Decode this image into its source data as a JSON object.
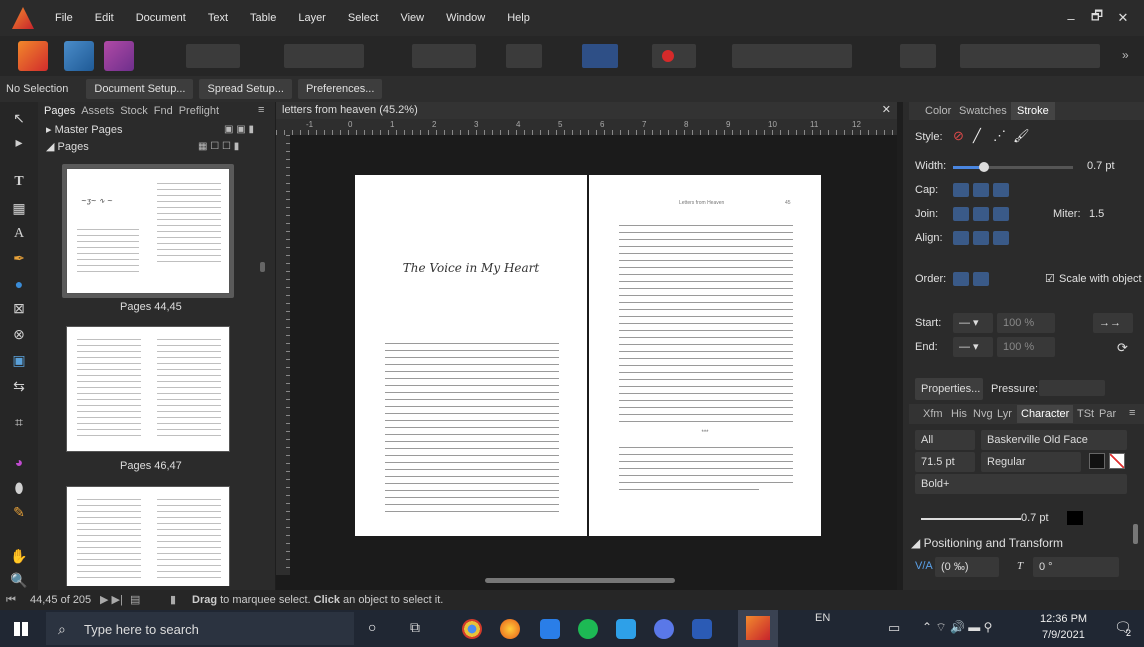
{
  "menubar": {
    "items": [
      "File",
      "Edit",
      "Document",
      "Text",
      "Table",
      "Layer",
      "Select",
      "View",
      "Window",
      "Help"
    ],
    "minimize": "–",
    "restore": "🗗",
    "close": "✕"
  },
  "context": {
    "selection": "No Selection",
    "buttons": [
      "Document Setup...",
      "Spread Setup...",
      "Preferences..."
    ]
  },
  "pages_panel": {
    "tabs": [
      "Pages",
      "Assets",
      "Stock",
      "Fnd",
      "Preflight"
    ],
    "master_pages": "Master Pages",
    "pages": "Pages",
    "spreads": [
      "Pages 44,45",
      "Pages 46,47"
    ]
  },
  "document": {
    "tab_title": "letters from heaven (45.2%)",
    "close": "✕",
    "ruler_numbers": [
      "-1",
      "0",
      "1",
      "2",
      "3",
      "4",
      "5",
      "6",
      "7",
      "8",
      "9",
      "10",
      "11",
      "12"
    ],
    "left_page_title": "The Voice in My Heart",
    "right_header": "Letters from Heaven",
    "right_page_number": "45",
    "separator": "***"
  },
  "stroke_panel": {
    "tabs": [
      "Color",
      "Swatches",
      "Stroke"
    ],
    "style_label": "Style:",
    "width_label": "Width:",
    "width_value": "0.7 pt",
    "cap_label": "Cap:",
    "join_label": "Join:",
    "miter_label": "Miter:",
    "miter_value": "1.5",
    "align_label": "Align:",
    "order_label": "Order:",
    "scale_with_object": "Scale with object",
    "start_label": "Start:",
    "start_percent": "100 %",
    "end_label": "End:",
    "end_percent": "100 %",
    "properties_button": "Properties...",
    "pressure_label": "Pressure:"
  },
  "character_panel": {
    "tabs": [
      "Xfm",
      "His",
      "Nvg",
      "Lyr",
      "Character",
      "TSt",
      "Par"
    ],
    "scope": "All",
    "font_family": "Baskerville Old Face",
    "font_size": "71.5 pt",
    "font_style": "Regular",
    "bold_option": "Bold+",
    "stroke_value": "0.7 pt",
    "section_title": "Positioning and Transform",
    "kerning": "(0 ‰)",
    "skew": "0 °"
  },
  "statusbar": {
    "pages": "44,45 of 205",
    "hint_drag": "Drag",
    "hint_mid": " to marquee select. ",
    "hint_click": "Click",
    "hint_end": " an object to select it."
  },
  "taskbar": {
    "search_placeholder": "Type here to search",
    "lang": "EN",
    "time": "12:36 PM",
    "date": "7/9/2021",
    "notification_count": "2"
  },
  "colors": {
    "accent": "#3a5a88",
    "affinity_orange": "#e0522a"
  }
}
